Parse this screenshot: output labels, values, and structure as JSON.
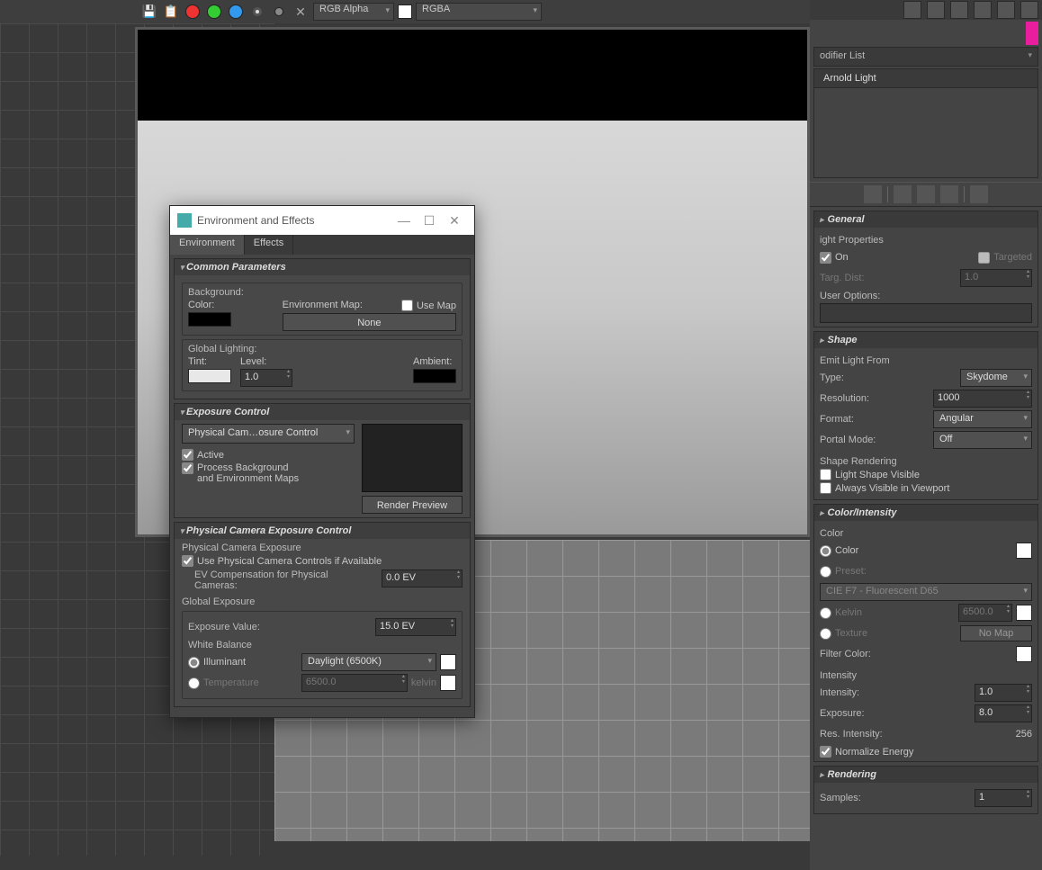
{
  "toolbar": {
    "dropdown1": "RGB Alpha",
    "dropdown2": "RGBA"
  },
  "right_panel": {
    "modifier_list_label": "odifier List",
    "stack_item": "Arnold Light",
    "general": {
      "title": "General",
      "light_properties": "ight Properties",
      "on": "On",
      "targeted": "Targeted",
      "targ_dist_label": "Targ. Dist:",
      "targ_dist_value": "1.0",
      "user_options": "User Options:"
    },
    "shape": {
      "title": "Shape",
      "emit_from": "Emit Light From",
      "type_label": "Type:",
      "type_value": "Skydome",
      "resolution_label": "Resolution:",
      "resolution_value": "1000",
      "format_label": "Format:",
      "format_value": "Angular",
      "portal_mode_label": "Portal Mode:",
      "portal_mode_value": "Off",
      "shape_rendering": "Shape Rendering",
      "light_shape_visible": "Light Shape Visible",
      "always_visible": "Always Visible in Viewport"
    },
    "color_intensity": {
      "title": "Color/Intensity",
      "color_header": "Color",
      "color": "Color",
      "preset": "Preset:",
      "preset_value": "CIE F7 - Fluorescent D65",
      "kelvin": "Kelvin",
      "kelvin_value": "6500.0",
      "texture": "Texture",
      "no_map": "No Map",
      "filter_color": "Filter Color:",
      "intensity_header": "Intensity",
      "intensity_label": "Intensity:",
      "intensity_value": "1.0",
      "exposure_label": "Exposure:",
      "exposure_value": "8.0",
      "res_intensity_label": "Res. Intensity:",
      "res_intensity_value": "256",
      "normalize": "Normalize Energy"
    },
    "rendering": {
      "title": "Rendering",
      "samples_label": "Samples:",
      "samples_value": "1"
    }
  },
  "dialog": {
    "title": "Environment and Effects",
    "tab1": "Environment",
    "tab2": "Effects",
    "common": {
      "title": "Common Parameters",
      "background": "Background:",
      "color": "Color:",
      "env_map": "Environment Map:",
      "use_map": "Use Map",
      "none": "None",
      "global_lighting": "Global Lighting:",
      "tint": "Tint:",
      "level": "Level:",
      "level_value": "1.0",
      "ambient": "Ambient:"
    },
    "exposure": {
      "title": "Exposure Control",
      "dropdown": "Physical Cam…osure Control",
      "active": "Active",
      "process_bg": "Process Background\nand Environment Maps",
      "render_preview": "Render Preview"
    },
    "physical": {
      "title": "Physical Camera Exposure Control",
      "header": "Physical Camera Exposure",
      "use_physical": "Use Physical Camera Controls if Available",
      "ev_comp": "EV Compensation for Physical\nCameras:",
      "ev_comp_value": "0.0 EV",
      "global_exposure": "Global Exposure",
      "exposure_value_label": "Exposure Value:",
      "exposure_value": "15.0 EV",
      "white_balance": "White Balance",
      "illuminant": "Illuminant",
      "illuminant_value": "Daylight (6500K)",
      "temperature": "Temperature",
      "temperature_value": "6500.0",
      "kelvin": "kelvin"
    }
  }
}
